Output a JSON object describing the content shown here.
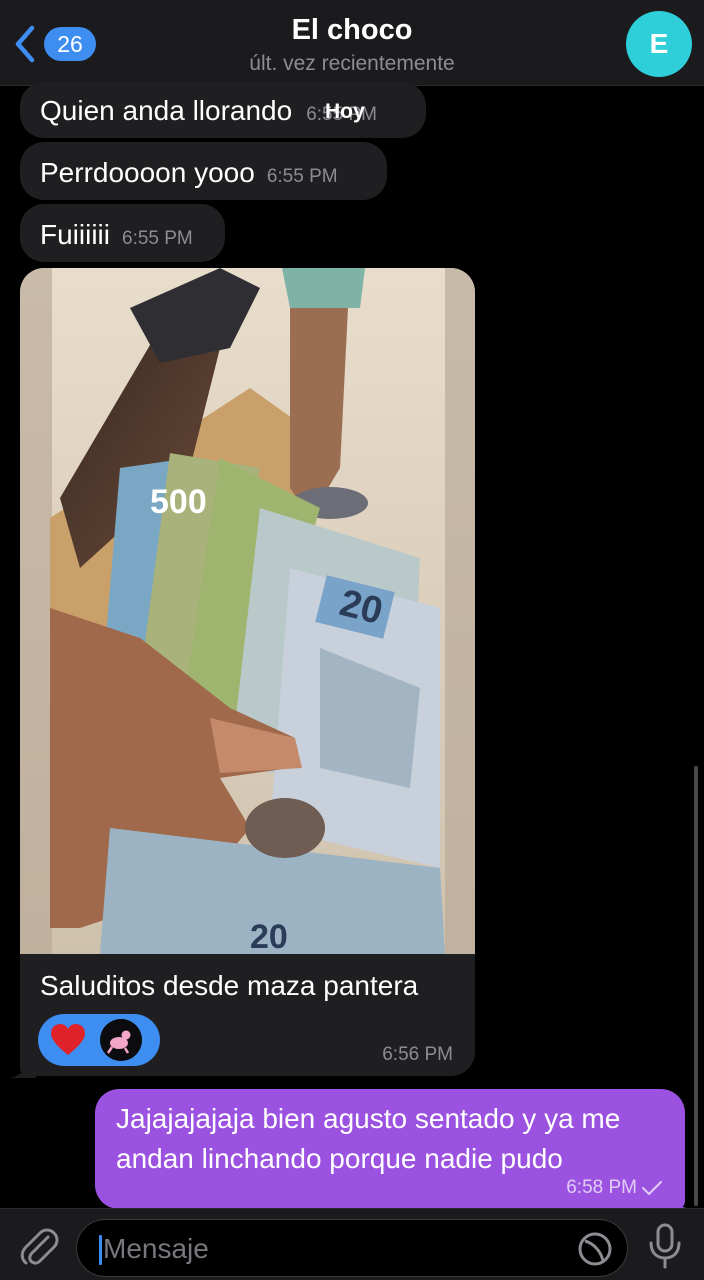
{
  "header": {
    "back_count": "26",
    "title": "El choco",
    "subtitle": "últ. vez recientemente",
    "avatar_letter": "E",
    "avatar_color": "#2ecfd8"
  },
  "date_separator": "Hoy",
  "messages": [
    {
      "text": "Quien anda llorando",
      "time": "6:55 PM"
    },
    {
      "text": "Perrdoooon yooo",
      "time": "6:55 PM"
    },
    {
      "text": "Fuiiiiii",
      "time": "6:55 PM"
    }
  ],
  "photo_message": {
    "caption": "Saluditos desde maza pantera",
    "time": "6:56 PM",
    "reactions": [
      "heart-emoji",
      "pink-panther-avatar"
    ]
  },
  "outgoing": {
    "text": "Jajajajajaja bien agusto sentado y ya me andan linchando porque nadie pudo",
    "time": "6:58 PM",
    "status": "sent-check"
  },
  "input": {
    "placeholder": "Mensaje"
  },
  "colors": {
    "accent": "#3e8df0",
    "outgoing_bubble": "#9b52e0",
    "incoming_bubble": "#1f1f21"
  }
}
